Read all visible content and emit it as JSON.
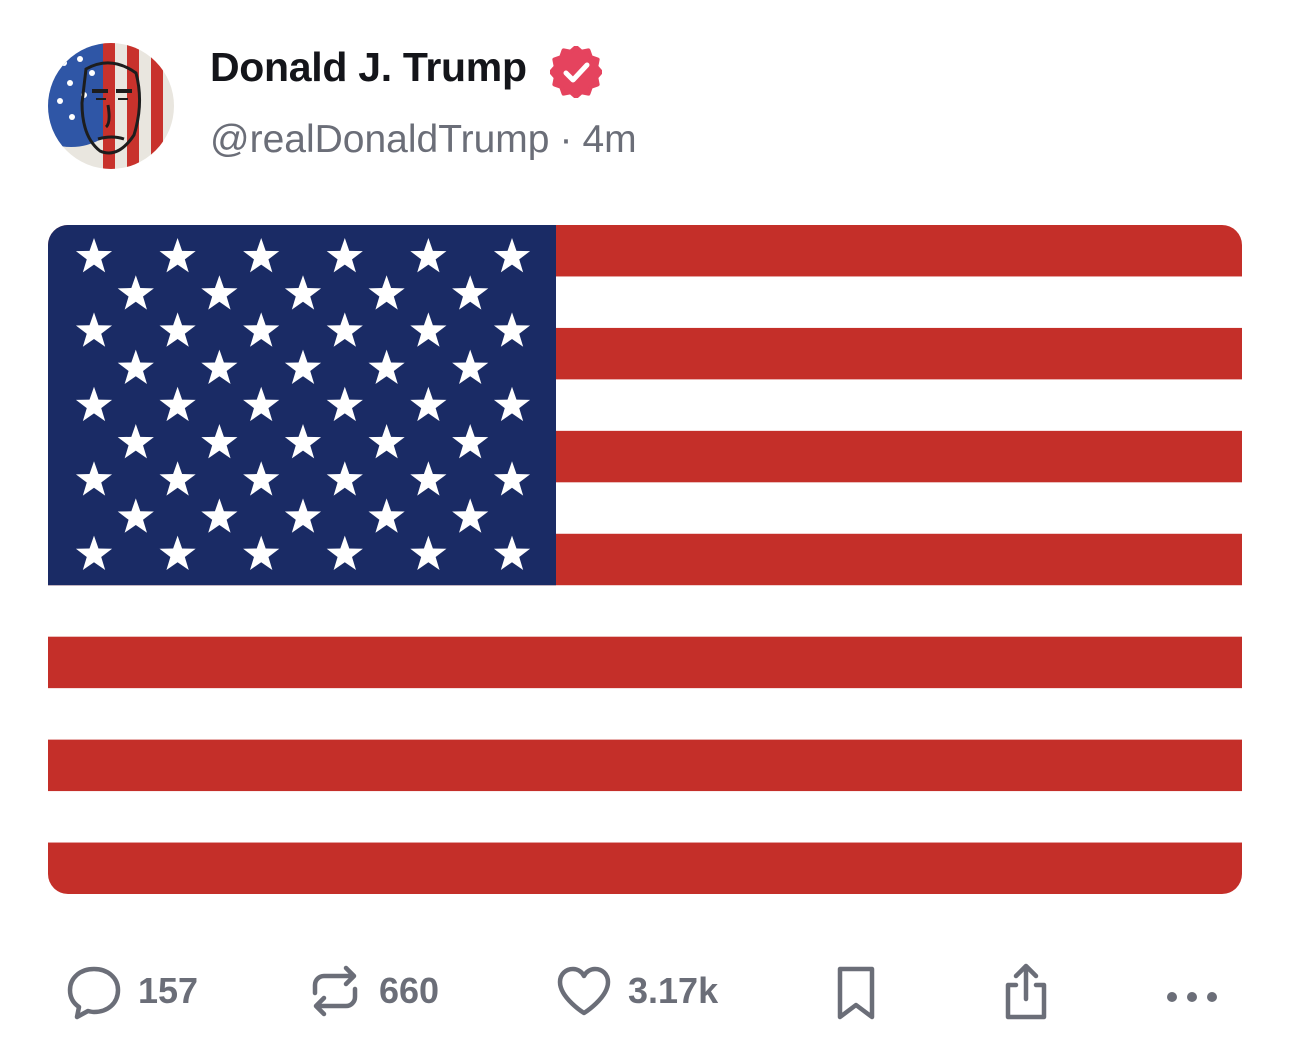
{
  "post": {
    "author": {
      "display_name": "Donald J. Trump",
      "handle": "@realDonaldTrump",
      "verified": true,
      "verified_badge_color": "#e5435e"
    },
    "separator": "·",
    "time_ago": "4m",
    "media": {
      "type": "image",
      "subject": "us-flag",
      "colors": {
        "red": "#c42f29",
        "white": "#ffffff",
        "blue": "#1a2b65"
      }
    },
    "actions": {
      "reply": {
        "icon": "reply-icon",
        "count": "157"
      },
      "retruth": {
        "icon": "retruth-icon",
        "count": "660"
      },
      "like": {
        "icon": "heart-icon",
        "count": "3.17k"
      },
      "bookmark": {
        "icon": "bookmark-icon"
      },
      "share": {
        "icon": "share-icon"
      },
      "more": {
        "icon": "more-icon"
      }
    },
    "colors": {
      "text_primary": "#14151a",
      "text_secondary": "#6b6e78"
    }
  }
}
